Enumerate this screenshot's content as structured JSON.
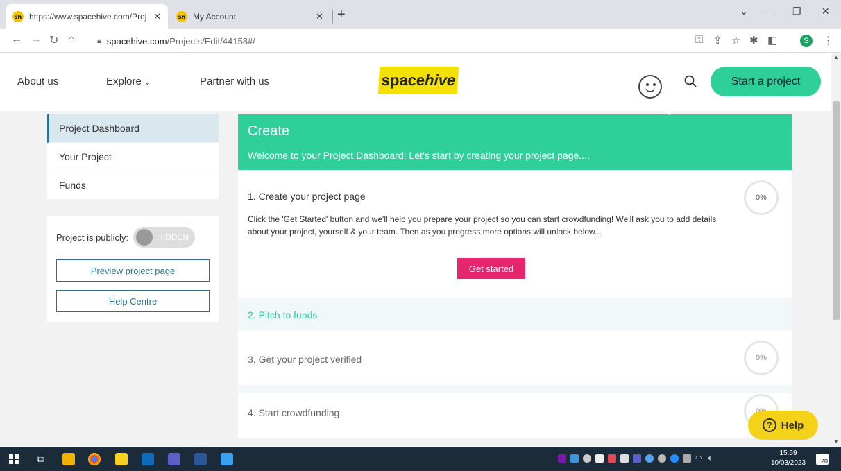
{
  "browser": {
    "tabs": [
      {
        "title": "https://www.spacehive.com/Proj",
        "active": true,
        "favicon": "sh"
      },
      {
        "title": "My Account",
        "active": false,
        "favicon": "sh"
      }
    ],
    "url_host": "spacehive.com",
    "url_path": "/Projects/Edit/44158#/",
    "profile_initial": "S"
  },
  "header": {
    "nav": [
      "About us",
      "Explore",
      "Partner with us"
    ],
    "logo_plain": "space",
    "logo_italic": "hive",
    "start_button": "Start a project",
    "brand_color": "#2ecf98"
  },
  "sidebar": {
    "items": [
      {
        "label": "Project Dashboard",
        "active": true
      },
      {
        "label": "Your Project",
        "active": false
      },
      {
        "label": "Funds",
        "active": false
      }
    ],
    "public_label": "Project is publicly:",
    "toggle_state": "HIDDEN",
    "preview_button": "Preview project page",
    "help_centre_button": "Help Centre"
  },
  "main": {
    "title": "Create",
    "subtitle": "Welcome to your Project Dashboard! Let’s start by creating your project page....",
    "steps": [
      {
        "title": "1. Create your project page",
        "progress": "0%",
        "description": "Click the 'Get Started' button and we'll help you prepare your project so you can start crowdfunding! We'll ask you to add details about your project, yourself & your team. Then as you progress more options will unlock below...",
        "button": "Get started"
      },
      {
        "title": "2. Pitch to funds"
      },
      {
        "title": "3. Get your project verified",
        "progress": "0%"
      },
      {
        "title": "4. Start crowdfunding",
        "progress": "0%"
      }
    ],
    "accent_pink": "#e5266c"
  },
  "help_widget": {
    "label": "Help",
    "icon": "?"
  },
  "taskbar": {
    "time": "15:59",
    "date": "10/03/2023",
    "notifications": "20"
  }
}
